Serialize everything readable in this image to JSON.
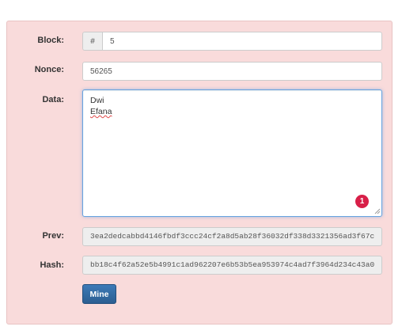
{
  "block": {
    "label": "Block:",
    "addon": "#",
    "value": "5"
  },
  "nonce": {
    "label": "Nonce:",
    "value": "56265"
  },
  "data": {
    "label": "Data:",
    "line1": "Dwi",
    "line2": "Efana",
    "badge": "1"
  },
  "prev": {
    "label": "Prev:",
    "value": "3ea2dedcabbd4146fbdf3ccc24cf2a8d5ab28f36032df338d3321356ad3f67c"
  },
  "hash": {
    "label": "Hash:",
    "value": "bb18c4f62a52e5b4991c1ad962207e6b53b5ea953974c4ad7f3964d234c43a0"
  },
  "mine_button": {
    "label": "Mine"
  },
  "colors": {
    "panel_bg": "#f9dbdb",
    "button": "#2c5e91",
    "badge": "#d81f48"
  }
}
